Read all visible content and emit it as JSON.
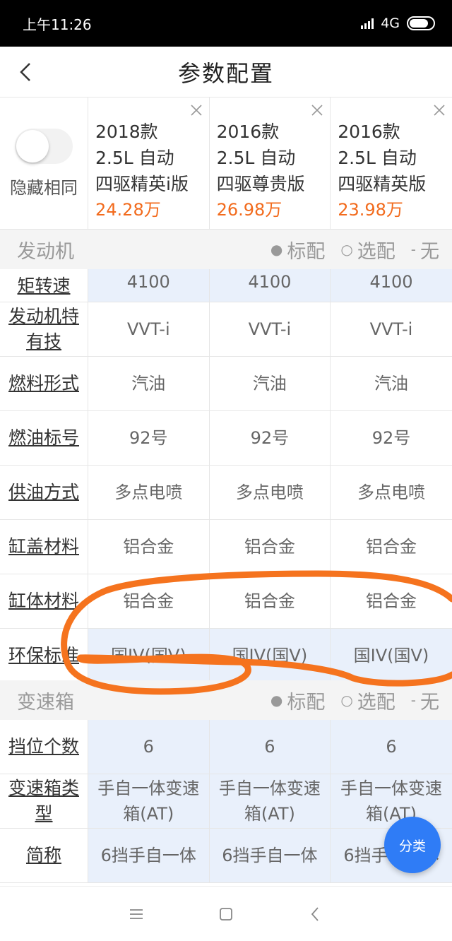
{
  "status_bar": {
    "time": "上午11:26",
    "network": "4G"
  },
  "header": {
    "title": "参数配置"
  },
  "hide_same": {
    "label": "隐藏相同"
  },
  "cars": [
    {
      "year": "2018款",
      "spec": "2.5L 自动",
      "trim": "四驱精英i版",
      "price": "24.28万"
    },
    {
      "year": "2016款",
      "spec": "2.5L 自动",
      "trim": "四驱尊贵版",
      "price": "26.98万"
    },
    {
      "year": "2016款",
      "spec": "2.5L 自动",
      "trim": "四驱精英版",
      "price": "23.98万"
    }
  ],
  "legend": {
    "standard": "标配",
    "optional": "选配",
    "none": "无",
    "standard_mark": "●",
    "optional_mark": "○",
    "none_mark": "-"
  },
  "sections": [
    {
      "title": "发动机",
      "rows": [
        {
          "label": "矩转速",
          "values": [
            "4100",
            "4100",
            "4100"
          ]
        },
        {
          "label": "发动机特有技",
          "values": [
            "VVT-i",
            "VVT-i",
            "VVT-i"
          ]
        },
        {
          "label": "燃料形式",
          "values": [
            "汽油",
            "汽油",
            "汽油"
          ]
        },
        {
          "label": "燃油标号",
          "values": [
            "92号",
            "92号",
            "92号"
          ]
        },
        {
          "label": "供油方式",
          "values": [
            "多点电喷",
            "多点电喷",
            "多点电喷"
          ]
        },
        {
          "label": "缸盖材料",
          "values": [
            "铝合金",
            "铝合金",
            "铝合金"
          ]
        },
        {
          "label": "缸体材料",
          "values": [
            "铝合金",
            "铝合金",
            "铝合金"
          ]
        },
        {
          "label": "环保标准",
          "values": [
            "国IV(国V)",
            "国IV(国V)",
            "国IV(国V)"
          ]
        }
      ]
    },
    {
      "title": "变速箱",
      "rows": [
        {
          "label": "挡位个数",
          "values": [
            "6",
            "6",
            "6"
          ]
        },
        {
          "label": "变速箱类型",
          "values": [
            "手自一体变速箱(AT)",
            "手自一体变速箱(AT)",
            "手自一体变速箱(AT)"
          ]
        },
        {
          "label": "简称",
          "values": [
            "6挡手自一体",
            "6挡手自一体",
            "6挡手自一体"
          ]
        }
      ]
    }
  ],
  "fab": {
    "label": "分类"
  },
  "colors": {
    "price": "#f26b1d",
    "highlight_row": "#e9f0fb",
    "fab": "#2f7cf6",
    "annotation": "#f5731e"
  }
}
